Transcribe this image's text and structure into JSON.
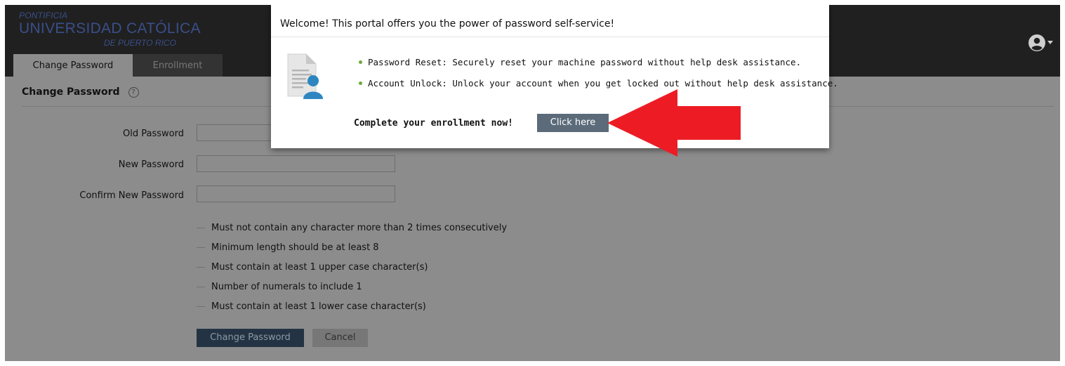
{
  "brand": {
    "line1": "PONTIFICIA",
    "line2": "UNIVERSIDAD CATÓLICA",
    "line3": "DE PUERTO RICO"
  },
  "tabs": [
    {
      "label": "Change Password",
      "active": true
    },
    {
      "label": "Enrollment",
      "active": false
    }
  ],
  "user_menu": {
    "icon": "user-circle-icon",
    "caret": "caret-down-icon"
  },
  "page": {
    "title": "Change Password",
    "help_icon": "question-circle-icon",
    "help_glyph": "?"
  },
  "form": {
    "fields": [
      {
        "label": "Old Password",
        "value": ""
      },
      {
        "label": "New Password",
        "value": ""
      },
      {
        "label": "Confirm New Password",
        "value": ""
      }
    ],
    "rules": [
      "Must not contain any character more than 2 times consecutively",
      "Minimum length should be at least 8",
      "Must contain at least 1 upper case character(s)",
      "Number of numerals to include 1",
      "Must contain at least 1 lower case character(s)"
    ],
    "submit_label": "Change Password",
    "cancel_label": "Cancel"
  },
  "modal": {
    "title": "Welcome! This portal offers you the power of password self-service!",
    "icon": "document-user-icon",
    "bullets": [
      "Password Reset: Securely reset your machine password without help desk assistance.",
      "Account Unlock: Unlock your account when you get locked out without help desk assistance."
    ],
    "cta_text": "Complete your enrollment now!",
    "cta_button": "Click here"
  },
  "annotation": {
    "icon": "red-arrow-icon",
    "color": "#ed1c24"
  },
  "colors": {
    "overlay": "#8c8c8c",
    "header": "#202020",
    "brand": "#3a4f8a",
    "primary_button": "#233344",
    "cta_button": "#5b6b7a",
    "bullet": "#6aaa3a"
  }
}
